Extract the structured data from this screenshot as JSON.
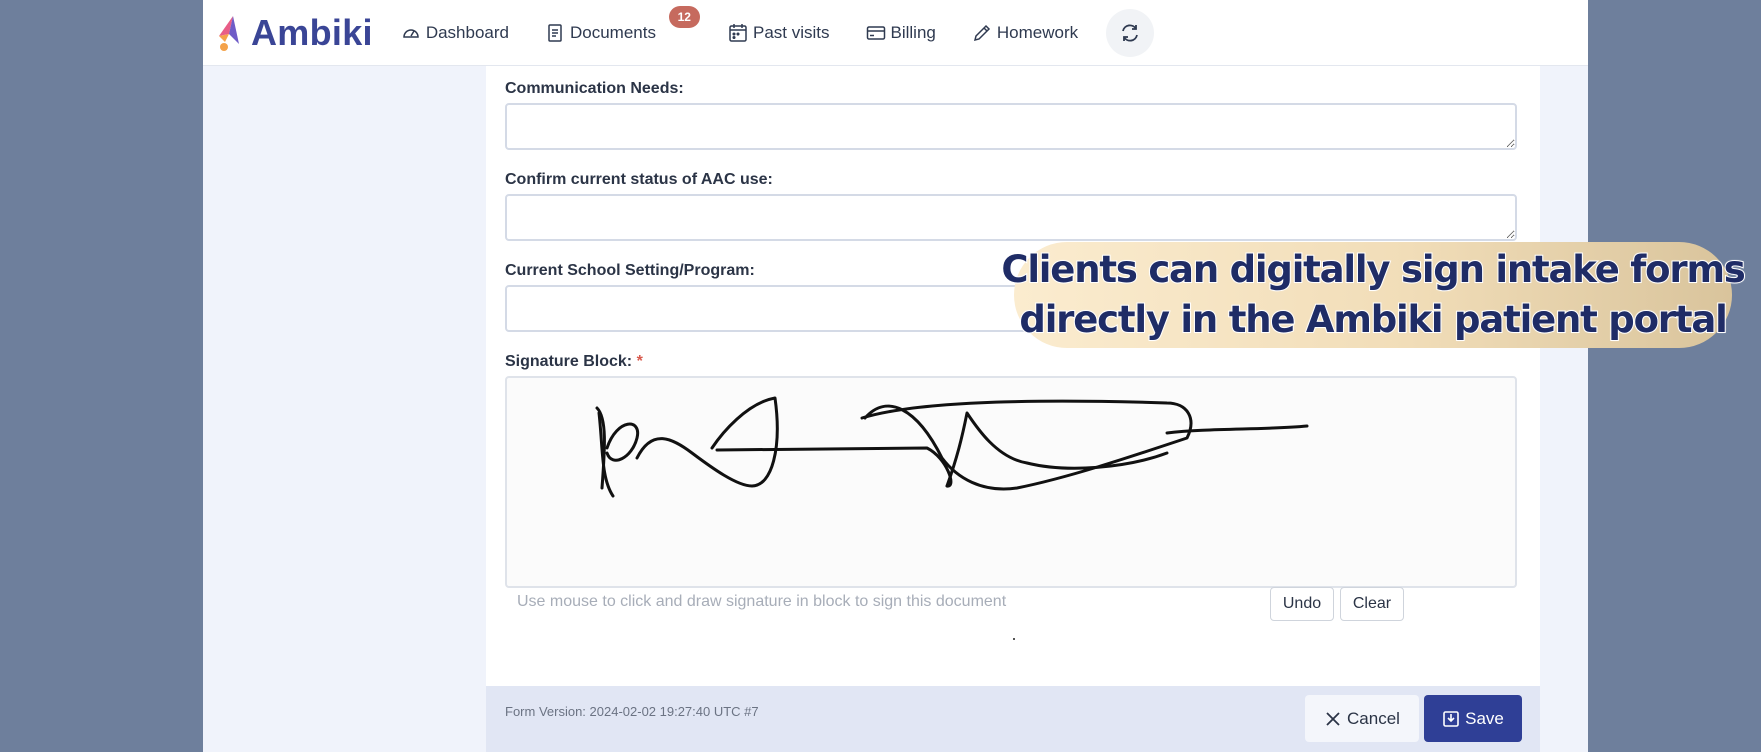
{
  "brand": {
    "name": "Ambiki",
    "accent": "#3a4596"
  },
  "nav": {
    "dashboard": "Dashboard",
    "documents": "Documents",
    "documents_badge": "12",
    "past_visits": "Past visits",
    "billing": "Billing",
    "homework": "Homework"
  },
  "form": {
    "communication_needs": "Communication Needs:",
    "aac_status": "Confirm current status of AAC use:",
    "school_setting": "Current School Setting/Program:",
    "signature_label": "Signature Block:",
    "required_mark": "*",
    "signature_hint": "Use mouse to click and draw signature in block to sign this document",
    "undo": "Undo",
    "clear": "Clear"
  },
  "footer": {
    "form_version": "Form Version: 2024-02-02 19:27:40 UTC #7",
    "cancel": "Cancel",
    "save": "Save"
  },
  "overlay": {
    "line1": "Clients can digitally sign intake forms",
    "line2": "directly in the Ambiki patient portal"
  },
  "colors": {
    "save_button": "#2f3f96",
    "badge": "#c66a5e",
    "page_background": "#6e7f9c"
  }
}
